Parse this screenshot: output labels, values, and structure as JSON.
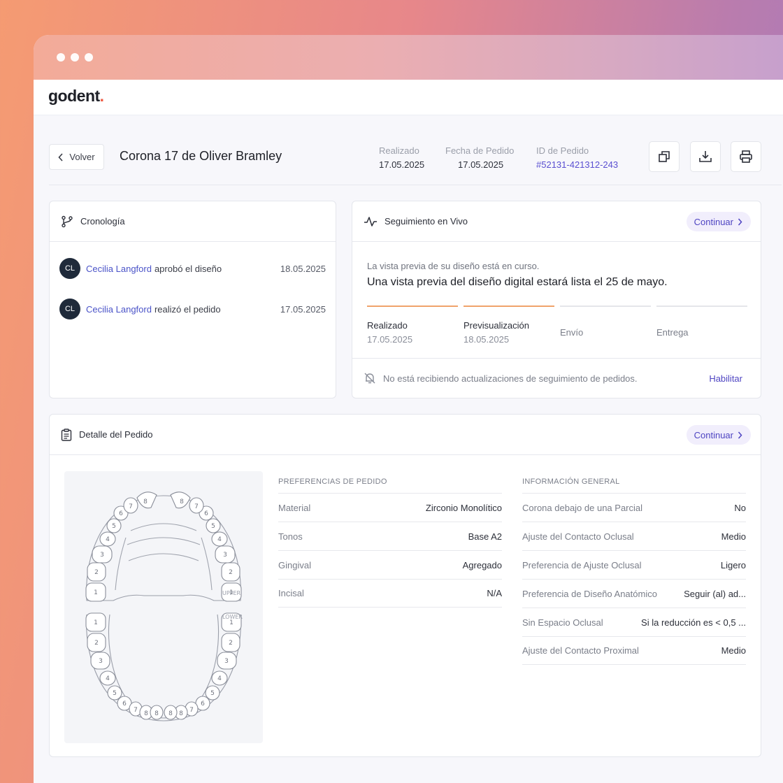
{
  "app": {
    "logo": "godent",
    "logo_dot": "."
  },
  "header": {
    "back_label": "Volver",
    "title": "Corona 17 de Oliver Bramley",
    "meta": [
      {
        "label": "Realizado",
        "value": "17.05.2025"
      },
      {
        "label": "Fecha de Pedido",
        "value": "17.05.2025"
      },
      {
        "label": "ID de Pedido",
        "value": "#52131-421312-243"
      }
    ],
    "actions": [
      "copy-icon",
      "download-icon",
      "print-icon"
    ]
  },
  "timeline": {
    "title": "Cronología",
    "items": [
      {
        "initials": "CL",
        "name": "Cecilia Langford",
        "action": "aprobó el diseño",
        "date": "18.05.2025"
      },
      {
        "initials": "CL",
        "name": "Cecilia Langford",
        "action": "realizó el pedido",
        "date": "17.05.2025"
      }
    ]
  },
  "tracking": {
    "title": "Seguimiento en Vivo",
    "continue_label": "Continuar",
    "subtitle": "La vista previa de su diseño está en curso.",
    "message": "Una vista previa del diseño digital estará lista el 25 de mayo.",
    "steps": [
      {
        "label": "Realizado",
        "date": "17.05.2025",
        "done": true
      },
      {
        "label": "Previsualización",
        "date": "18.05.2025",
        "done": true
      },
      {
        "label": "Envío",
        "date": "",
        "done": false
      },
      {
        "label": "Entrega",
        "date": "",
        "done": false
      }
    ],
    "notice": "No está recibiendo actualizaciones de seguimiento de pedidos.",
    "enable_label": "Habilitar"
  },
  "order_detail": {
    "title": "Detalle del Pedido",
    "continue_label": "Continuar",
    "chart": {
      "upper_label": "UPPER",
      "lower_label": "LOWER"
    },
    "preferences": {
      "title": "PREFERENCIAS DE PEDIDO",
      "rows": [
        {
          "key": "Material",
          "value": "Zirconio Monolítico"
        },
        {
          "key": "Tonos",
          "value": "Base A2"
        },
        {
          "key": "Gingival",
          "value": "Agregado"
        },
        {
          "key": "Incisal",
          "value": "N/A"
        }
      ]
    },
    "general": {
      "title": "INFORMACIÓN GENERAL",
      "rows": [
        {
          "key": "Corona debajo de una Parcial",
          "value": "No"
        },
        {
          "key": "Ajuste del Contacto Oclusal",
          "value": "Medio"
        },
        {
          "key": "Preferencia de Ajuste Oclusal",
          "value": "Ligero"
        },
        {
          "key": "Preferencia de Diseño Anatómico",
          "value": "Seguir (al) ad..."
        },
        {
          "key": "Sin Espacio Oclusal",
          "value": "Si la reducción es < 0,5 ..."
        },
        {
          "key": "Ajuste del Contacto Proximal",
          "value": "Medio"
        }
      ]
    }
  }
}
